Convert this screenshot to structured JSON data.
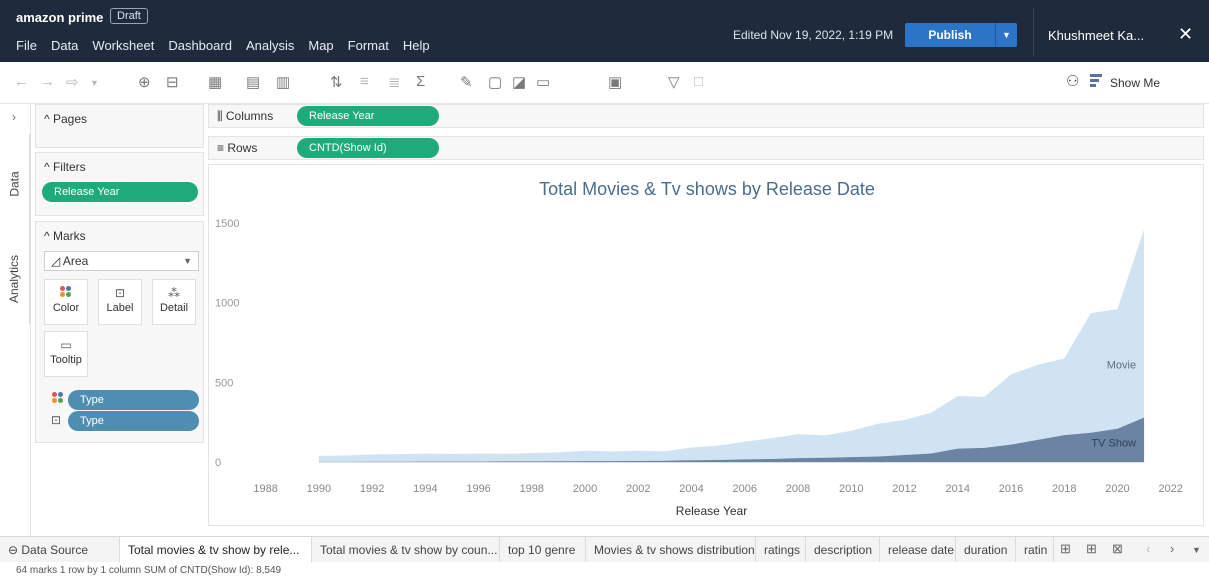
{
  "header": {
    "brand": "amazon prime",
    "draft_badge": "Draft",
    "menu": [
      "File",
      "Data",
      "Worksheet",
      "Dashboard",
      "Analysis",
      "Map",
      "Format",
      "Help"
    ],
    "edited": "Edited Nov 19, 2022, 1:19 PM",
    "publish_label": "Publish",
    "user": "Khushmeet Ka...",
    "close": "✕"
  },
  "toolbar": {
    "show_me": "Show Me"
  },
  "sidebar": {
    "data_tab": "Data",
    "analytics_tab": "Analytics",
    "pages_title": "Pages",
    "filters_title": "Filters",
    "filter_pill": "Release Year",
    "marks_title": "Marks",
    "mark_type": "Area",
    "mark_buttons": [
      "Color",
      "Label",
      "Detail",
      "Tooltip"
    ],
    "mark_fields": [
      "Type",
      "Type"
    ]
  },
  "shelves": {
    "columns_label": "Columns",
    "columns_pill": "Release Year",
    "rows_label": "Rows",
    "rows_pill": "CNTD(Show Id)"
  },
  "chart_data": {
    "type": "area",
    "title": "Total Movies & Tv shows by Release Date",
    "xlabel": "Release Year",
    "ylabel": "",
    "x_ticks": [
      "1988",
      "1990",
      "1992",
      "1994",
      "1996",
      "1998",
      "2000",
      "2002",
      "2004",
      "2006",
      "2008",
      "2010",
      "2012",
      "2014",
      "2016",
      "2018",
      "2020",
      "2022"
    ],
    "y_ticks": [
      "0",
      "500",
      "1000",
      "1500"
    ],
    "xlim": [
      1987,
      2022.5
    ],
    "ylim": [
      -30,
      1550
    ],
    "stacked": true,
    "series": [
      {
        "name": "TV Show",
        "color": "#6b84a3",
        "x": [
          1990,
          1991,
          1992,
          1993,
          1994,
          1995,
          1996,
          1997,
          1998,
          1999,
          2000,
          2001,
          2002,
          2003,
          2004,
          2005,
          2006,
          2007,
          2008,
          2009,
          2010,
          2011,
          2012,
          2013,
          2014,
          2015,
          2016,
          2017,
          2018,
          2019,
          2020,
          2021
        ],
        "values": [
          2,
          2,
          3,
          3,
          4,
          4,
          4,
          5,
          5,
          6,
          7,
          7,
          8,
          9,
          12,
          14,
          18,
          20,
          26,
          28,
          32,
          36,
          45,
          55,
          85,
          90,
          110,
          140,
          170,
          185,
          210,
          280
        ]
      },
      {
        "name": "Movie",
        "color": "#cfe3f2",
        "x": [
          1990,
          1991,
          1992,
          1993,
          1994,
          1995,
          1996,
          1997,
          1998,
          1999,
          2000,
          2001,
          2002,
          2003,
          2004,
          2005,
          2006,
          2007,
          2008,
          2009,
          2010,
          2011,
          2012,
          2013,
          2014,
          2015,
          2016,
          2017,
          2018,
          2019,
          2020,
          2021
        ],
        "values": [
          38,
          40,
          45,
          48,
          50,
          48,
          50,
          48,
          52,
          56,
          65,
          60,
          64,
          60,
          80,
          90,
          110,
          130,
          150,
          140,
          165,
          205,
          220,
          255,
          330,
          320,
          440,
          470,
          480,
          750,
          750,
          1180
        ]
      }
    ]
  },
  "tabs": {
    "data_source": "Data Source",
    "sheets": [
      "Total movies & tv show by rele...",
      "Total movies & tv show by coun...",
      "top 10 genre",
      "Movies & tv shows distribution",
      "ratings",
      "description",
      "release date",
      "duration",
      "ratin"
    ]
  },
  "status": {
    "text": "64 marks   1 row by 1 column   SUM of CNTD(Show Id): 8,549"
  }
}
